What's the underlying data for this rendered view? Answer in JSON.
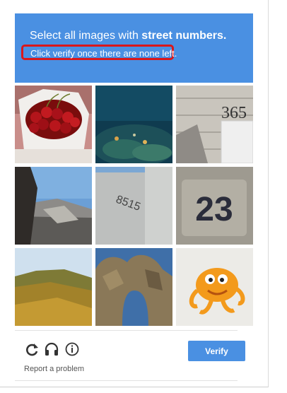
{
  "challenge": {
    "instruction_prefix": "Select all images with ",
    "instruction_target": "street numbers.",
    "subtext": "Click verify once there are none left."
  },
  "tiles": [
    {
      "subject": "red cherries in a white paper cone"
    },
    {
      "subject": "underwater rocks and fish"
    },
    {
      "subject": "house number 365 on siding",
      "text": "365"
    },
    {
      "subject": "rocky cliff coastline"
    },
    {
      "subject": "number 8515 on a wall",
      "text": "8515"
    },
    {
      "subject": "blurry number 23",
      "text": "23"
    },
    {
      "subject": "grassy hillside landscape"
    },
    {
      "subject": "rock arch formation"
    },
    {
      "subject": "orange cartoon character"
    }
  ],
  "footer": {
    "icons": [
      "reload-icon",
      "audio-headphones-icon",
      "info-icon"
    ],
    "verify_label": "Verify",
    "report_label": "Report a problem"
  },
  "colors": {
    "header_blue": "#4a90e2",
    "highlight_red": "#d9171b",
    "verify_blue": "#4a90e2"
  }
}
